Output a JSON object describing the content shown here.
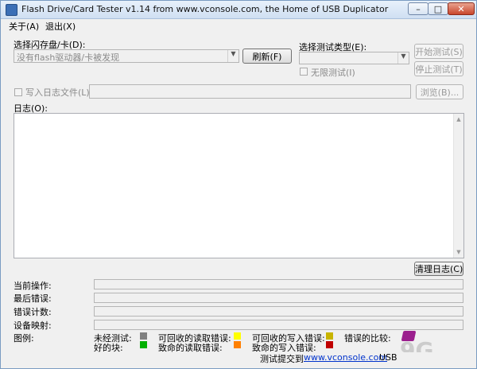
{
  "window": {
    "title": "Flash Drive/Card Tester v1.14 from www.vconsole.com, the Home of USB Duplicator",
    "min_glyph": "–",
    "max_glyph": "□",
    "close_glyph": "✕"
  },
  "menu": {
    "about": "关于(A)",
    "exit": "退出(X)"
  },
  "drive": {
    "label": "选择闪存盘/卡(D):",
    "selected": "没有flash驱动器/卡被发现",
    "refresh": "刷新(F)"
  },
  "test_type": {
    "label": "选择测试类型(E):",
    "selected": "",
    "unlimited": "无限测试(I)"
  },
  "buttons": {
    "start": "开始测试(S)",
    "stop": "停止测试(T)",
    "browse": "浏览(B)...",
    "clear_log": "清理日志(C)"
  },
  "logfile": {
    "label": "写入日志文件(L)",
    "value": ""
  },
  "log": {
    "label": "日志(O):"
  },
  "status": {
    "current_op": "当前操作:",
    "last_error": "最后错误:",
    "error_count": "错误计数:",
    "device_map": "设备映射:"
  },
  "legend": {
    "label": "图例:",
    "items": [
      {
        "label": "未经测试:",
        "color": "#808080"
      },
      {
        "label": "可回收的读取错误:",
        "color": "#ffff00"
      },
      {
        "label": "可回收的写入错误:",
        "color": "#c8b400"
      },
      {
        "label": "错误的比较:",
        "color": "#800080"
      },
      {
        "label": "好的块:",
        "color": "#00b000"
      },
      {
        "label": "致命的读取错误:",
        "color": "#ff8000"
      },
      {
        "label": "致命的写入错误:",
        "color": "#c00000"
      }
    ]
  },
  "footer": {
    "prefix": "测试提交到",
    "link": "www.vconsole.com",
    "suffix": "USB"
  }
}
